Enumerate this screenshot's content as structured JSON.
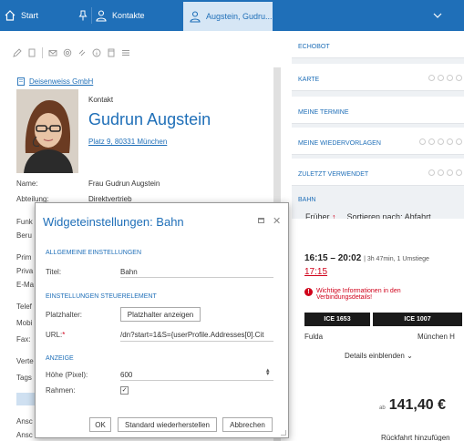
{
  "tabs": {
    "start": "Start",
    "kontakte": "Kontakte",
    "active": "Augstein, Gudru..."
  },
  "contact": {
    "company": "Deisenweiss GmbH",
    "type": "Kontakt",
    "name": "Gudrun Augstein",
    "address": "Platz 9, 80331 München",
    "fields": [
      {
        "label": "Name:",
        "value": "Frau Gudrun Augstein"
      },
      {
        "label": "Abteilung:",
        "value": "Direktvertrieb"
      }
    ],
    "cutoff_labels": [
      "Funk",
      "Beru",
      "Prim",
      "Priva",
      "E-Ma",
      "Telef",
      "Mobi",
      "Fax:",
      "Verte",
      "Tags",
      "Ansc",
      "Ansc"
    ]
  },
  "widgets": [
    {
      "title": "ECHOBOT"
    },
    {
      "title": "KARTE"
    },
    {
      "title": "MEINE TERMINE"
    },
    {
      "title": "MEINE WIEDERVORLAGEN"
    },
    {
      "title": "ZULETZT VERWENDET"
    }
  ],
  "bahn": {
    "title": "BAHN",
    "filter_earlier": "Früher",
    "filter_sort": "Sortieren nach: Abfahrt",
    "journey_time": "16:15 – 20:02",
    "journey_meta": "| 3h 47min, 1 Umstiege",
    "journey_alt": "17:15",
    "warning": "Wichtige Informationen in den Verbindungsdetails!",
    "trains": [
      "ICE 1653",
      "ICE 1007"
    ],
    "from": "Fulda",
    "to": "München H",
    "details": "Details einblenden",
    "price_prefix": "ab",
    "price": "141,40 €",
    "return": "Rückfahrt hinzufügen"
  },
  "dialog": {
    "title": "Widgeteinstellungen: Bahn",
    "section_general": "ALLGEMEINE EINSTELLUNGEN",
    "title_label": "Titel:",
    "title_value": "Bahn",
    "section_control": "EINSTELLUNGEN STEUERELEMENT",
    "placeholder_label": "Platzhalter:",
    "placeholder_button": "Platzhalter anzeigen",
    "url_label": "URL:",
    "url_required": "*",
    "url_value": "/dn?start=1&S={userProfile.Addresses[0].Cit",
    "section_display": "ANZEIGE",
    "height_label": "Höhe (Pixel):",
    "height_value": "600",
    "frame_label": "Rahmen:",
    "frame_checked": "✓",
    "ok": "OK",
    "reset": "Standard wiederherstellen",
    "cancel": "Abbrechen"
  }
}
